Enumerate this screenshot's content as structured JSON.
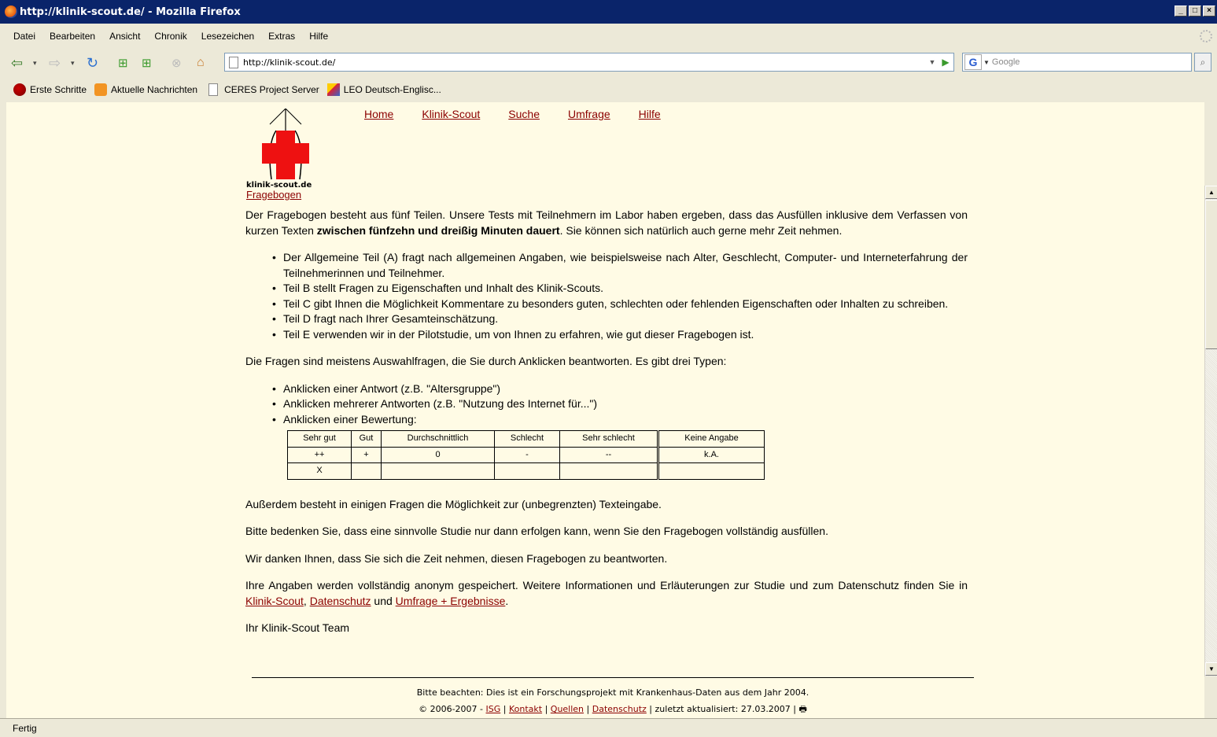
{
  "window": {
    "title": "http://klinik-scout.de/ - Mozilla Firefox",
    "buttons": [
      "_",
      "×"
    ]
  },
  "menu": [
    "Datei",
    "Bearbeiten",
    "Ansicht",
    "Chronik",
    "Lesezeichen",
    "Extras",
    "Hilfe"
  ],
  "navbar": {
    "url": "http://klinik-scout.de/",
    "search_placeholder": "Google"
  },
  "bookmarks": [
    "Erste Schritte",
    "Aktuelle Nachrichten",
    "CERES Project Server",
    "LEO Deutsch-Englisc..."
  ],
  "site": {
    "logo_text": "klinik-scout.de",
    "logo_link": "Fragebogen",
    "topnav": [
      "Home",
      "Klinik-Scout",
      "Suche",
      "Umfrage",
      "Hilfe"
    ],
    "intro_1": "Der Fragebogen besteht aus fünf Teilen. Unsere Tests mit Teilnehmern im Labor haben ergeben, dass das Ausfüllen inklusive dem Verfassen von kurzen Texten",
    "intro_bold": "zwischen fünfzehn und dreißig Minuten dauert",
    "intro_2": ". Sie können sich natürlich auch gerne mehr Zeit nehmen.",
    "parts": [
      "Der Allgemeine Teil (A) fragt nach allgemeinen Angaben, wie beispielsweise nach Alter, Geschlecht, Computer- und Interneterfahrung der Teilnehmerinnen und Teilnehmer.",
      "Teil B stellt Fragen zu Eigenschaften und Inhalt des Klinik-Scouts.",
      "Teil C gibt Ihnen die Möglichkeit Kommentare zu besonders guten, schlechten oder fehlenden Eigenschaften oder Inhalten zu schreiben.",
      "Teil D fragt nach Ihrer Gesamteinschätzung.",
      "Teil E verwenden wir in der Pilotstudie, um von Ihnen zu erfahren, wie gut dieser Fragebogen ist."
    ],
    "types_intro": "Die Fragen sind meistens Auswahlfragen, die Sie durch Anklicken beantworten. Es gibt drei Typen:",
    "types": [
      "Anklicken einer Antwort (z.B. \"Altersgruppe\")",
      "Anklicken mehrerer Antworten (z.B. \"Nutzung des Internet für...\")",
      "Anklicken einer Bewertung:"
    ],
    "rating_table": {
      "headers": [
        "Sehr gut",
        "Gut",
        "Durchschnittlich",
        "Schlecht",
        "Sehr schlecht",
        "Keine Angabe"
      ],
      "symbols": [
        "++",
        "+",
        "0",
        "-",
        "--",
        "k.A."
      ],
      "selected": [
        "X",
        "",
        "",
        "",
        "",
        ""
      ]
    },
    "text_input": "Außerdem besteht in einigen Fragen die Möglichkeit zur (unbegrenzten) Texteingabe.",
    "complete": "Bitte bedenken Sie, dass eine sinnvolle Studie nur dann erfolgen kann, wenn Sie den Fragebogen vollständig ausfüllen.",
    "thanks": "Wir danken Ihnen, dass Sie sich die Zeit nehmen, diesen Fragebogen zu beantworten.",
    "anon_1": "Ihre Angaben werden vollständig anonym gespeichert. Weitere Informationen und Erläuterungen zur Studie und zum Datenschutz finden Sie in",
    "anon_link_1": "Klinik-Scout",
    "anon_sep": ",",
    "anon_link_2": "Datenschutz",
    "anon_and": "und",
    "anon_link_3": "Umfrage + Ergebnisse",
    "anon_end": ".",
    "signature": "Ihr Klinik-Scout Team",
    "footer_note": "Bitte beachten: Dies ist ein Forschungsprojekt mit Krankenhaus-Daten aus dem Jahr 2004.",
    "footer_copy": "© 2006-2007 -",
    "footer_links": [
      "ISG",
      "Kontakt",
      "Quellen",
      "Datenschutz"
    ],
    "footer_updated": "zuletzt aktualisiert: 27.03.2007"
  },
  "status": "Fertig"
}
